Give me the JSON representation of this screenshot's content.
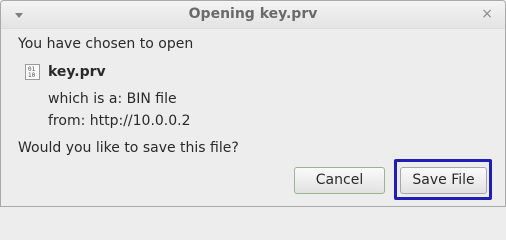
{
  "window": {
    "title": "Opening key.prv",
    "close_glyph": "×",
    "menu_icon": "chevron-down-icon"
  },
  "dialog": {
    "intro": "You have chosen to open",
    "file_icon": "binary-file-icon",
    "file_icon_lines": [
      "01",
      "10"
    ],
    "file_name": "key.prv",
    "file_type": "which is a:  BIN file",
    "file_source": "from:  http://10.0.0.2",
    "question": "Would you like to save this file?"
  },
  "buttons": {
    "cancel_label": "Cancel",
    "save_label": "Save File"
  },
  "colors": {
    "highlight": "#1f1fb4",
    "background": "#ededed"
  }
}
